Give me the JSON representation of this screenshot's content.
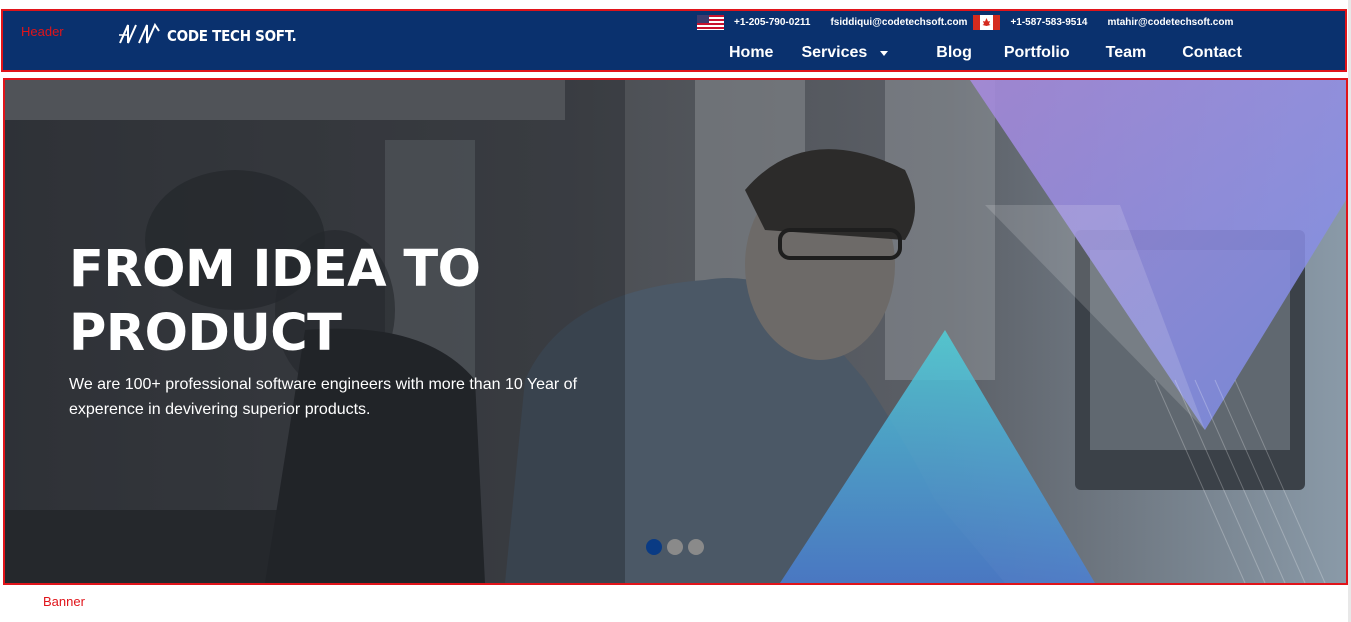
{
  "annotations": {
    "header": "Header",
    "banner": "Banner"
  },
  "header": {
    "logo_text": "CODE TECH SOFT.",
    "contacts": [
      {
        "flag": "us-flag-icon",
        "phone": "+1-205-790-0211",
        "email": "fsiddiqui@codetechsoft.com"
      },
      {
        "flag": "canada-flag-icon",
        "phone": "+1-587-583-9514",
        "email": "mtahir@codetechsoft.com"
      }
    ],
    "nav": [
      {
        "label": "Home"
      },
      {
        "label": "Services",
        "icon": "caret-down-icon"
      },
      {
        "label": "Blog"
      },
      {
        "label": "Portfolio"
      },
      {
        "label": "Team"
      },
      {
        "label": "Contact"
      }
    ]
  },
  "banner": {
    "title_line1": "FROM IDEA TO",
    "title_line2": "PRODUCT",
    "subtitle": "We are 100+ professional software engineers with more than 10 Year of experence in devivering superior products.",
    "slides_total": 3,
    "active_slide": 1
  },
  "colors": {
    "header_bg": "#0a316e",
    "annotation_red": "#e0141a",
    "active_dot": "#0a3b84",
    "inactive_dot": "#8a8a8a"
  }
}
